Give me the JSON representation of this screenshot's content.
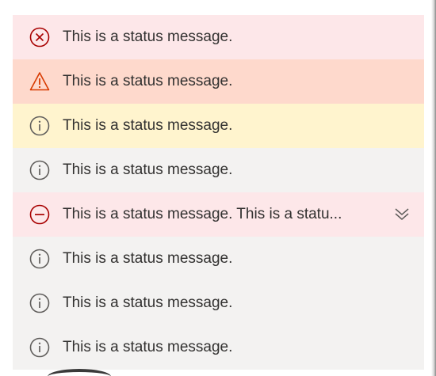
{
  "colors": {
    "error_bg": "#fde7e9",
    "error_icon": "#a80000",
    "warning_bg": "#fed9cc",
    "warning_icon": "#d83b01",
    "severe_bg": "#fff4ce",
    "info_bg": "#f3f2f1",
    "info_icon": "#605e5c",
    "text": "#323130"
  },
  "message_bars": [
    {
      "type": "error",
      "icon": "error-circle-x-icon",
      "text": "This is a status message."
    },
    {
      "type": "warning",
      "icon": "warning-triangle-icon",
      "text": "This is a status message."
    },
    {
      "type": "severe",
      "icon": "info-icon",
      "text": "This is a status message."
    },
    {
      "type": "info",
      "icon": "info-icon",
      "text": "This is a status message."
    },
    {
      "type": "blocked",
      "icon": "blocked-icon",
      "text": "This is a status message. This is a statu...",
      "expand_icon": "double-chevron-down-icon"
    },
    {
      "type": "info",
      "icon": "info-icon",
      "text": "This is a status message."
    },
    {
      "type": "info",
      "icon": "info-icon",
      "text": "This is a status message."
    },
    {
      "type": "info",
      "icon": "info-icon",
      "text": "This is a status message."
    }
  ]
}
